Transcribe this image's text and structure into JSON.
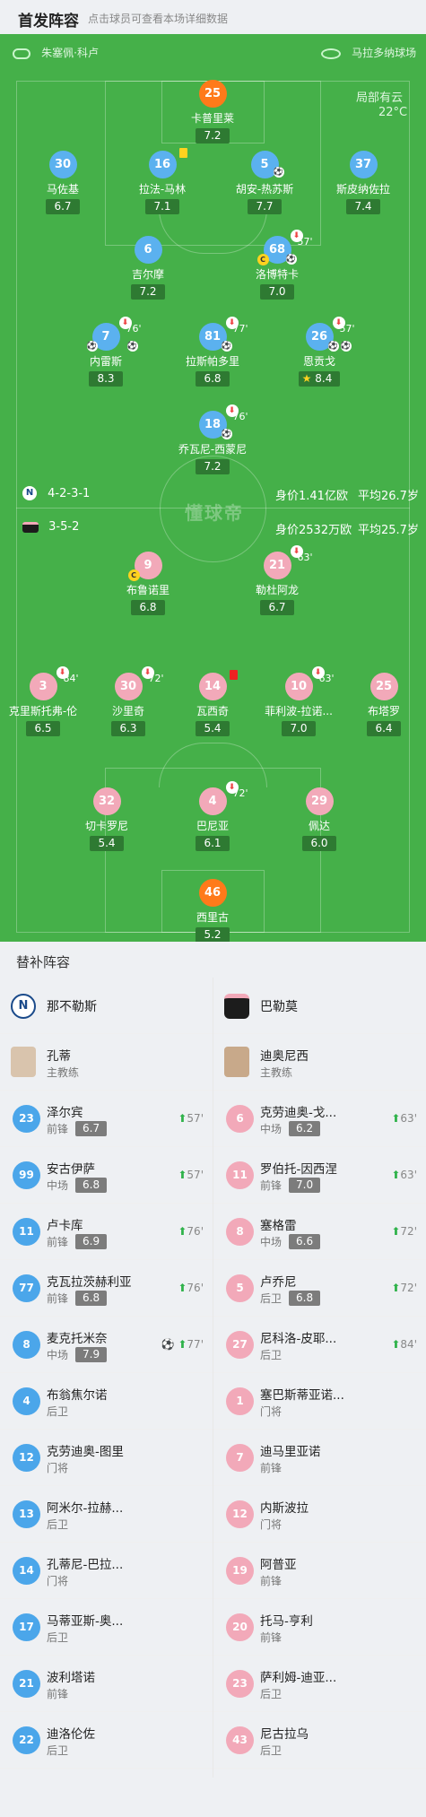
{
  "header": {
    "title": "首发阵容",
    "subtitle": "点击球员可查看本场详细数据"
  },
  "match_info": {
    "referee": "朱塞佩·科卢",
    "stadium": "马拉多纳球场",
    "weather": "局部有云",
    "temperature": "22°C",
    "watermark": "懂球帝"
  },
  "home": {
    "formation": "4-2-3-1",
    "value": "身价1.41亿欧",
    "age": "平均26.7岁"
  },
  "away": {
    "formation": "3-5-2",
    "value": "身价2532万欧",
    "age": "平均25.7岁"
  },
  "home_players": [
    {
      "num": "25",
      "name": "卡普里莱",
      "rating": "7.2"
    },
    {
      "num": "30",
      "name": "马佐基",
      "rating": "6.7"
    },
    {
      "num": "16",
      "name": "拉法-马林",
      "rating": "7.1"
    },
    {
      "num": "5",
      "name": "胡安-热苏斯",
      "rating": "7.7"
    },
    {
      "num": "37",
      "name": "斯皮纳佐拉",
      "rating": "7.4"
    },
    {
      "num": "6",
      "name": "吉尔摩",
      "rating": "7.2"
    },
    {
      "num": "68",
      "name": "洛博特卡",
      "rating": "7.0",
      "sub": "57'"
    },
    {
      "num": "7",
      "name": "内雷斯",
      "rating": "8.3",
      "sub": "76'"
    },
    {
      "num": "81",
      "name": "拉斯帕多里",
      "rating": "6.8",
      "sub": "77'"
    },
    {
      "num": "26",
      "name": "恩贡戈",
      "rating": "8.4",
      "sub": "57'"
    },
    {
      "num": "18",
      "name": "乔瓦尼-西蒙尼",
      "rating": "7.2",
      "sub": "76'"
    }
  ],
  "away_players": [
    {
      "num": "9",
      "name": "布鲁诺里",
      "rating": "6.8"
    },
    {
      "num": "21",
      "name": "勒杜阿龙",
      "rating": "6.7",
      "sub": "63'"
    },
    {
      "num": "3",
      "name": "克里斯托弗-伦",
      "rating": "6.5",
      "sub": "84'"
    },
    {
      "num": "30",
      "name": "沙里奇",
      "rating": "6.3",
      "sub": "72'"
    },
    {
      "num": "14",
      "name": "瓦西奇",
      "rating": "5.4"
    },
    {
      "num": "10",
      "name": "菲利波-拉诺...",
      "rating": "7.0",
      "sub": "63'"
    },
    {
      "num": "25",
      "name": "布塔罗",
      "rating": "6.4"
    },
    {
      "num": "32",
      "name": "切卡罗尼",
      "rating": "5.4"
    },
    {
      "num": "4",
      "name": "巴尼亚",
      "rating": "6.1",
      "sub": "72'"
    },
    {
      "num": "29",
      "name": "佩达",
      "rating": "6.0"
    },
    {
      "num": "46",
      "name": "西里古",
      "rating": "5.2"
    }
  ],
  "subs": {
    "title": "替补阵容",
    "home_team": "那不勒斯",
    "away_team": "巴勒莫",
    "home_coach": {
      "name": "孔蒂",
      "role": "主教练"
    },
    "away_coach": {
      "name": "迪奥尼西",
      "role": "主教练"
    },
    "home": [
      {
        "num": "23",
        "name": "泽尔宾",
        "pos": "前锋",
        "rating": "6.7",
        "ev": "57'"
      },
      {
        "num": "99",
        "name": "安古伊萨",
        "pos": "中场",
        "rating": "6.8",
        "ev": "57'"
      },
      {
        "num": "11",
        "name": "卢卡库",
        "pos": "前锋",
        "rating": "6.9",
        "ev": "76'"
      },
      {
        "num": "77",
        "name": "克瓦拉茨赫利亚",
        "pos": "前锋",
        "rating": "6.8",
        "ev": "76'"
      },
      {
        "num": "8",
        "name": "麦克托米奈",
        "pos": "中场",
        "rating": "7.9",
        "ev": "77'"
      },
      {
        "num": "4",
        "name": "布翁焦尔诺",
        "pos": "后卫"
      },
      {
        "num": "12",
        "name": "克劳迪奥-图里",
        "pos": "门将"
      },
      {
        "num": "13",
        "name": "阿米尔-拉赫...",
        "pos": "后卫"
      },
      {
        "num": "14",
        "name": "孔蒂尼-巴拉...",
        "pos": "门将"
      },
      {
        "num": "17",
        "name": "马蒂亚斯-奥...",
        "pos": "后卫"
      },
      {
        "num": "21",
        "name": "波利塔诺",
        "pos": "前锋"
      },
      {
        "num": "22",
        "name": "迪洛伦佐",
        "pos": "后卫"
      }
    ],
    "away": [
      {
        "num": "6",
        "name": "克劳迪奥-戈...",
        "pos": "中场",
        "rating": "6.2",
        "ev": "63'"
      },
      {
        "num": "11",
        "name": "罗伯托-因西涅",
        "pos": "前锋",
        "rating": "7.0",
        "ev": "63'"
      },
      {
        "num": "8",
        "name": "塞格雷",
        "pos": "中场",
        "rating": "6.6",
        "ev": "72'"
      },
      {
        "num": "5",
        "name": "卢乔尼",
        "pos": "后卫",
        "rating": "6.8",
        "ev": "72'"
      },
      {
        "num": "27",
        "name": "尼科洛-皮耶...",
        "pos": "后卫",
        "ev": "84'"
      },
      {
        "num": "1",
        "name": "塞巴斯蒂亚诺...",
        "pos": "门将"
      },
      {
        "num": "7",
        "name": "迪马里亚诺",
        "pos": "前锋"
      },
      {
        "num": "12",
        "name": "内斯波拉",
        "pos": "门将"
      },
      {
        "num": "19",
        "name": "阿普亚",
        "pos": "前锋"
      },
      {
        "num": "20",
        "name": "托马-亨利",
        "pos": "前锋"
      },
      {
        "num": "23",
        "name": "萨利姆-迪亚...",
        "pos": "后卫"
      },
      {
        "num": "43",
        "name": "尼古拉乌",
        "pos": "后卫"
      }
    ]
  }
}
